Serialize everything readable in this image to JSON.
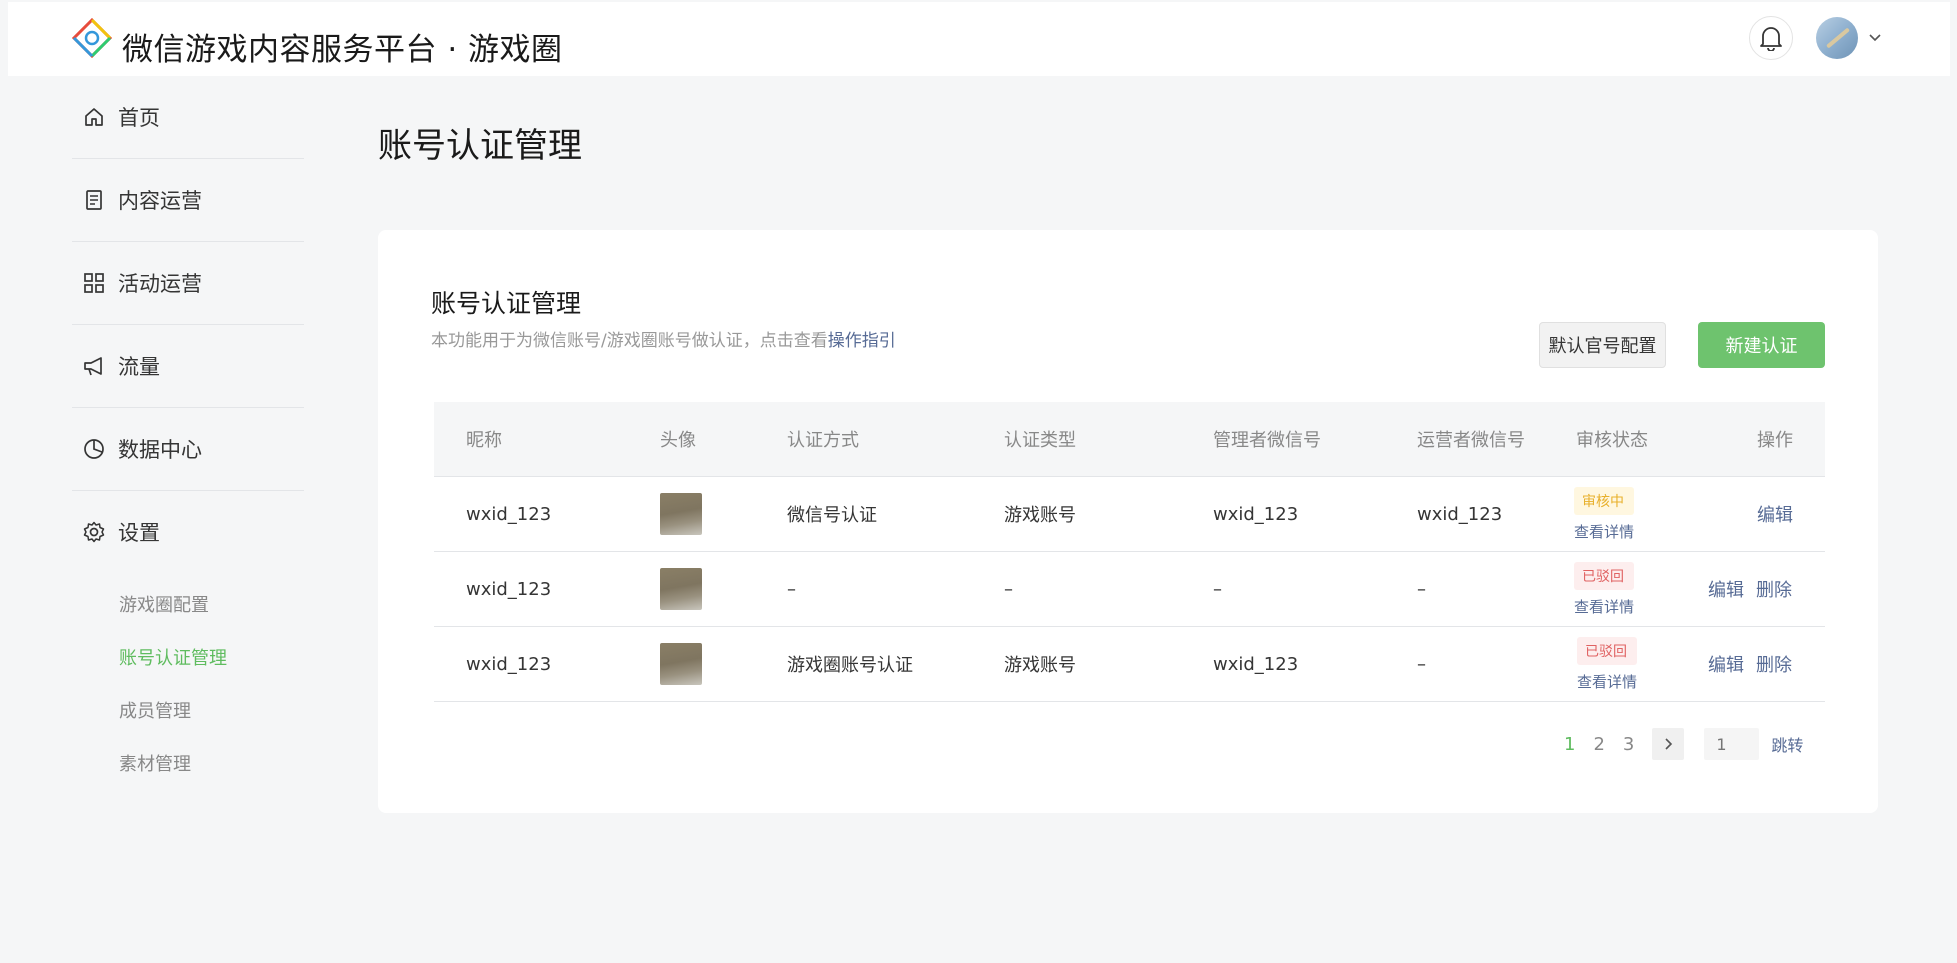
{
  "header": {
    "title": "微信游戏内容服务平台 · 游戏圈",
    "logo_icon": "diamond-logo-icon",
    "notification_icon": "bell-icon",
    "avatar_caret_icon": "chevron-down-icon"
  },
  "sidebar": {
    "items": [
      {
        "label": "首页",
        "icon": "home-icon"
      },
      {
        "label": "内容运营",
        "icon": "document-icon"
      },
      {
        "label": "活动运营",
        "icon": "grid-icon"
      },
      {
        "label": "流量",
        "icon": "megaphone-icon"
      },
      {
        "label": "数据中心",
        "icon": "pie-chart-icon"
      },
      {
        "label": "设置",
        "icon": "gear-icon"
      }
    ],
    "sub_items": [
      {
        "label": "游戏圈配置"
      },
      {
        "label": "账号认证管理",
        "active": true
      },
      {
        "label": "成员管理"
      },
      {
        "label": "素材管理"
      }
    ]
  },
  "page": {
    "title": "账号认证管理"
  },
  "card": {
    "title": "账号认证管理",
    "desc": "本功能用于为微信账号/游戏圈账号做认证，点击查看",
    "desc_link": "操作指引",
    "default_button": "默认官号配置",
    "primary_button": "新建认证"
  },
  "table": {
    "headers": {
      "nickname": "昵称",
      "avatar": "头像",
      "method": "认证方式",
      "type": "认证类型",
      "admin": "管理者微信号",
      "operator": "运营者微信号",
      "status": "审核状态",
      "action": "操作"
    },
    "rows": [
      {
        "nickname": "wxid_123",
        "method": "微信号认证",
        "type": "游戏账号",
        "admin": "wxid_123",
        "operator": "wxid_123",
        "status": "审核中",
        "status_kind": "pending",
        "detail": "查看详情",
        "edit": "编辑",
        "delete": ""
      },
      {
        "nickname": "wxid_123",
        "method": "–",
        "type": "–",
        "admin": "–",
        "operator": "–",
        "status": "已驳回",
        "status_kind": "rejected",
        "detail": "查看详情",
        "edit": "编辑",
        "delete": "删除"
      },
      {
        "nickname": "wxid_123",
        "method": "游戏圈账号认证",
        "type": "游戏账号",
        "admin": "wxid_123",
        "operator": "–",
        "status": "已驳回",
        "status_kind": "rejected",
        "detail": "查看详情",
        "edit": "编辑",
        "delete": "删除"
      }
    ]
  },
  "pagination": {
    "pages": [
      "1",
      "2",
      "3"
    ],
    "current": "1",
    "input_placeholder": "1",
    "jump": "跳转",
    "next_icon": "chevron-right-icon"
  }
}
